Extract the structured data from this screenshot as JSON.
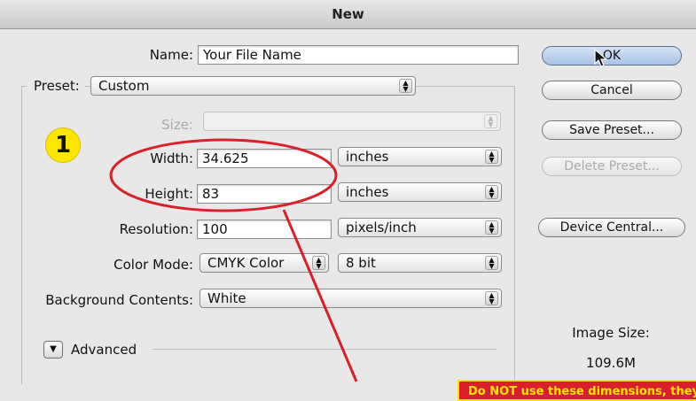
{
  "window": {
    "title": "New"
  },
  "form": {
    "name_label": "Name:",
    "name_value": "Your File Name",
    "preset_label": "Preset:",
    "preset_value": "Custom",
    "size_label": "Size:",
    "size_value": "",
    "width_label": "Width:",
    "width_value": "34.625",
    "width_unit": "inches",
    "height_label": "Height:",
    "height_value": "83",
    "height_unit": "inches",
    "resolution_label": "Resolution:",
    "resolution_value": "100",
    "resolution_unit": "pixels/inch",
    "color_mode_label": "Color Mode:",
    "color_mode_value": "CMYK Color",
    "bit_depth_value": "8 bit",
    "background_label": "Background Contents:",
    "background_value": "White",
    "advanced_label": "Advanced"
  },
  "buttons": {
    "ok": "OK",
    "cancel": "Cancel",
    "save_preset": "Save Preset...",
    "delete_preset": "Delete Preset...",
    "device_central": "Device Central..."
  },
  "image_size": {
    "label": "Image Size:",
    "value": "109.6M"
  },
  "annotation": {
    "step_number": "1",
    "callout_text": "Do NOT use these dimensions, they...",
    "highlight_color": "#d9202a",
    "badge_color": "#ffe600"
  }
}
